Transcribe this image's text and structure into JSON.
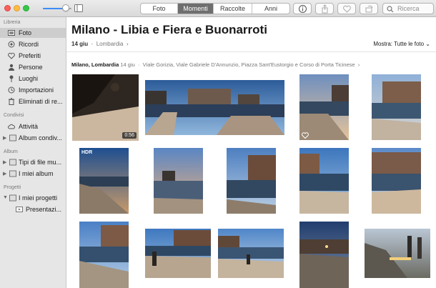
{
  "toolbar": {
    "tabs": [
      {
        "label": "Foto",
        "active": false
      },
      {
        "label": "Momenti",
        "active": true
      },
      {
        "label": "Raccolte",
        "active": false
      },
      {
        "label": "Anni",
        "active": false
      }
    ],
    "search_placeholder": "Ricerca",
    "zoom_level": 0.8
  },
  "sidebar": {
    "sections": [
      {
        "title": "Libreria"
      },
      {
        "title": "Condivisi"
      },
      {
        "title": "Album"
      },
      {
        "title": "Progetti"
      }
    ],
    "items": [
      {
        "label": "Foto",
        "icon": "photos-icon",
        "selected": true
      },
      {
        "label": "Ricordi",
        "icon": "memories-icon"
      },
      {
        "label": "Preferiti",
        "icon": "heart-icon"
      },
      {
        "label": "Persone",
        "icon": "person-icon"
      },
      {
        "label": "Luoghi",
        "icon": "pin-icon"
      },
      {
        "label": "Importazioni",
        "icon": "clock-icon"
      },
      {
        "label": "Eliminati di re...",
        "icon": "trash-icon"
      },
      {
        "label": "Attività",
        "icon": "cloud-icon"
      },
      {
        "label": "Album condiv...",
        "icon": "folder-icon"
      },
      {
        "label": "Tipi di file mu...",
        "icon": "folder-icon"
      },
      {
        "label": "I miei album",
        "icon": "folder-icon"
      },
      {
        "label": "I miei progetti",
        "icon": "folder-icon"
      },
      {
        "label": "Presentazi...",
        "icon": "slideshow-icon"
      }
    ]
  },
  "main": {
    "title": "Milano - Libia e Fiera e Buonarroti",
    "date": "14 giu",
    "region": "Lombardia",
    "show_label": "Mostra: Tutte le foto",
    "moment": {
      "place": "Milano, Lombardia",
      "date": "14 giu",
      "streets": "Viale Gorizia, Viale Gabriele D'Annunzio, Piazza Sant'Eustorgio e Corso di Porta Ticinese"
    },
    "photos": [
      {
        "kind": "video",
        "duration": "0:56"
      },
      {
        "kind": "panorama"
      },
      {
        "kind": "photo",
        "favorite": true
      },
      {
        "kind": "photo"
      },
      {
        "kind": "photo",
        "badge": "HDR"
      },
      {
        "kind": "photo"
      },
      {
        "kind": "photo"
      },
      {
        "kind": "photo"
      },
      {
        "kind": "photo"
      },
      {
        "kind": "photo"
      },
      {
        "kind": "photo"
      },
      {
        "kind": "photo"
      },
      {
        "kind": "photo"
      },
      {
        "kind": "photo"
      }
    ]
  }
}
